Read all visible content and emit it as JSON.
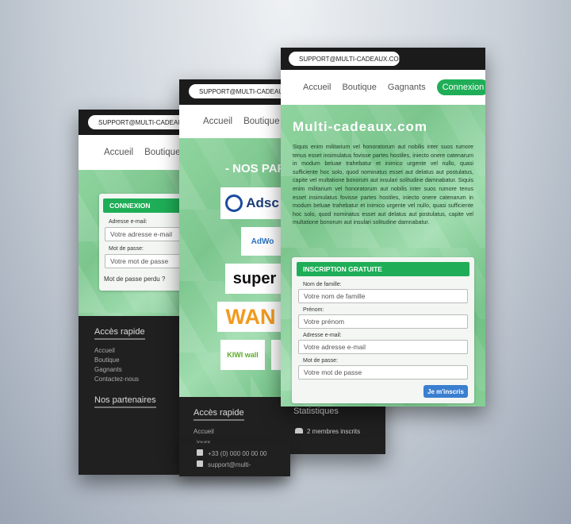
{
  "support_email": "SUPPORT@MULTI-CADEAUX.COM",
  "nav": {
    "home": "Accueil",
    "shop": "Boutique",
    "winners": "Gagnants",
    "login": "Connexion"
  },
  "login_screen": {
    "title": "CONNEXION",
    "email_label": "Adresse e-mail:",
    "email_placeholder": "Votre adresse e-mail",
    "password_label": "Mot de passe:",
    "password_placeholder": "Votre mot de passe",
    "forgot": "Mot de passe perdu ?",
    "quick_access": "Accès rapide",
    "links": [
      "Accueil",
      "Boutique",
      "Gagnants",
      "Contactez-nous"
    ],
    "partners": "Nos partenaires"
  },
  "partners_screen": {
    "title": "- NOS PAR",
    "logos": [
      "Adsc",
      "AdWo",
      "super",
      "WAN",
      "KIWI wall"
    ],
    "quick_access": "Accès rapide",
    "home": "Accueil",
    "days": "jours",
    "phone": "+33 (0) 000 00 00 00",
    "email": "support@multi-",
    "stats": "Statistiques",
    "members": "2 membres inscrits"
  },
  "signup_screen": {
    "site_title": "Multi-cadeaux.com",
    "intro": "Siquis enim militarium vel honoratorum aut nobilis inter suos rumore tenus esset insimulatus fovisse partes hostiles, iniecto onere catenarum in modum beluae trahebatur et inimico urgente vel nullo, quasi sufficiente hoc solo, quod nominatus esset aut delatus aut postulatus, capite vel multatione bonorum aut insulari solitudine damnabatur. Siquis enim militarium vel honoratorum aut nobilis inter suos rumore tenus esset insimulatus fovisse partes hostiles, iniecto onere catenarum in modum beluae trahebatur et inimico urgente vel nullo, quasi sufficiente hoc solo, quod nominatus esset aut delatus aut postulatus, capite vel multatione bonorum aut insulari solitudine damnabatur.",
    "form_title": "INSCRIPTION GRATUITE",
    "lastname_label": "Nom de famille:",
    "lastname_placeholder": "Votre nom de famille",
    "firstname_label": "Prénom:",
    "firstname_placeholder": "Votre prénom",
    "email_label": "Adresse e-mail:",
    "email_placeholder": "Votre adresse e-mail",
    "password_label": "Mot de passe:",
    "password_placeholder": "Votre mot de passe",
    "submit": "Je m'inscris"
  },
  "colors": {
    "accent": "#1fae57",
    "button": "#3a7fd0",
    "dark": "#202020"
  }
}
